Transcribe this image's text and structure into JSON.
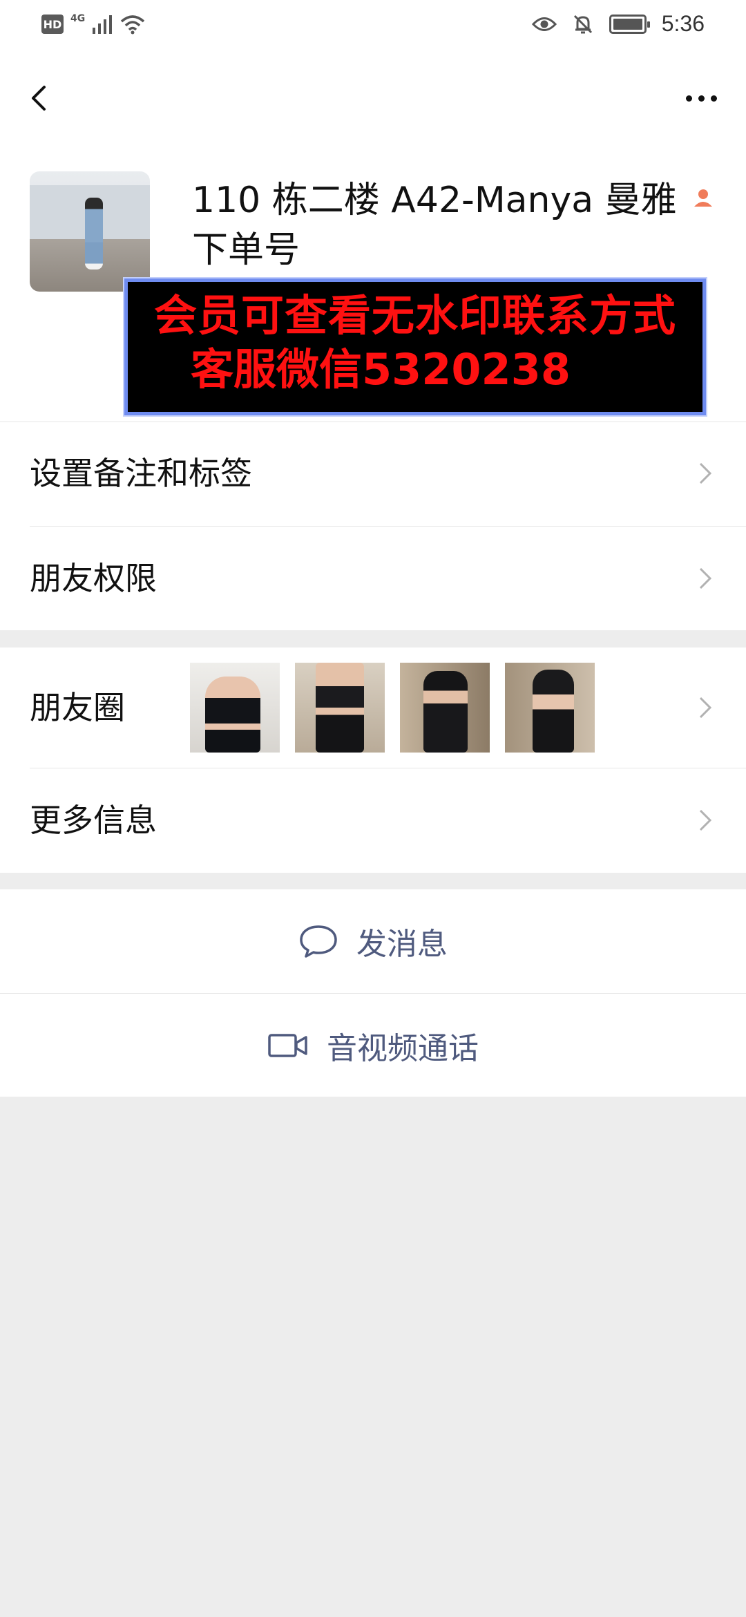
{
  "status_bar": {
    "hd_label": "HD",
    "network_label": "4G",
    "time": "5:36",
    "battery_level": 0.9
  },
  "nav": {
    "back_icon": "chevron-left-icon",
    "more_icon": "more-dots-icon"
  },
  "profile": {
    "display_name": "110 栋二楼 A42-Manya 曼雅下单号",
    "badge_icon": "person-badge-icon",
    "watermark_line1": "会员可查看无水印联系方式",
    "watermark_line2": "客服微信5320238"
  },
  "rows": {
    "remarks_tags": "设置备注和标签",
    "friend_permissions": "朋友权限",
    "moments": "朋友圈",
    "more_info": "更多信息"
  },
  "actions": {
    "send_message": "发消息",
    "video_call": "音视频通话"
  },
  "colors": {
    "action_text": "#4f5a7e",
    "watermark_text": "#ff1111",
    "watermark_border": "#6f8cf0",
    "badge": "#f07c5a"
  }
}
